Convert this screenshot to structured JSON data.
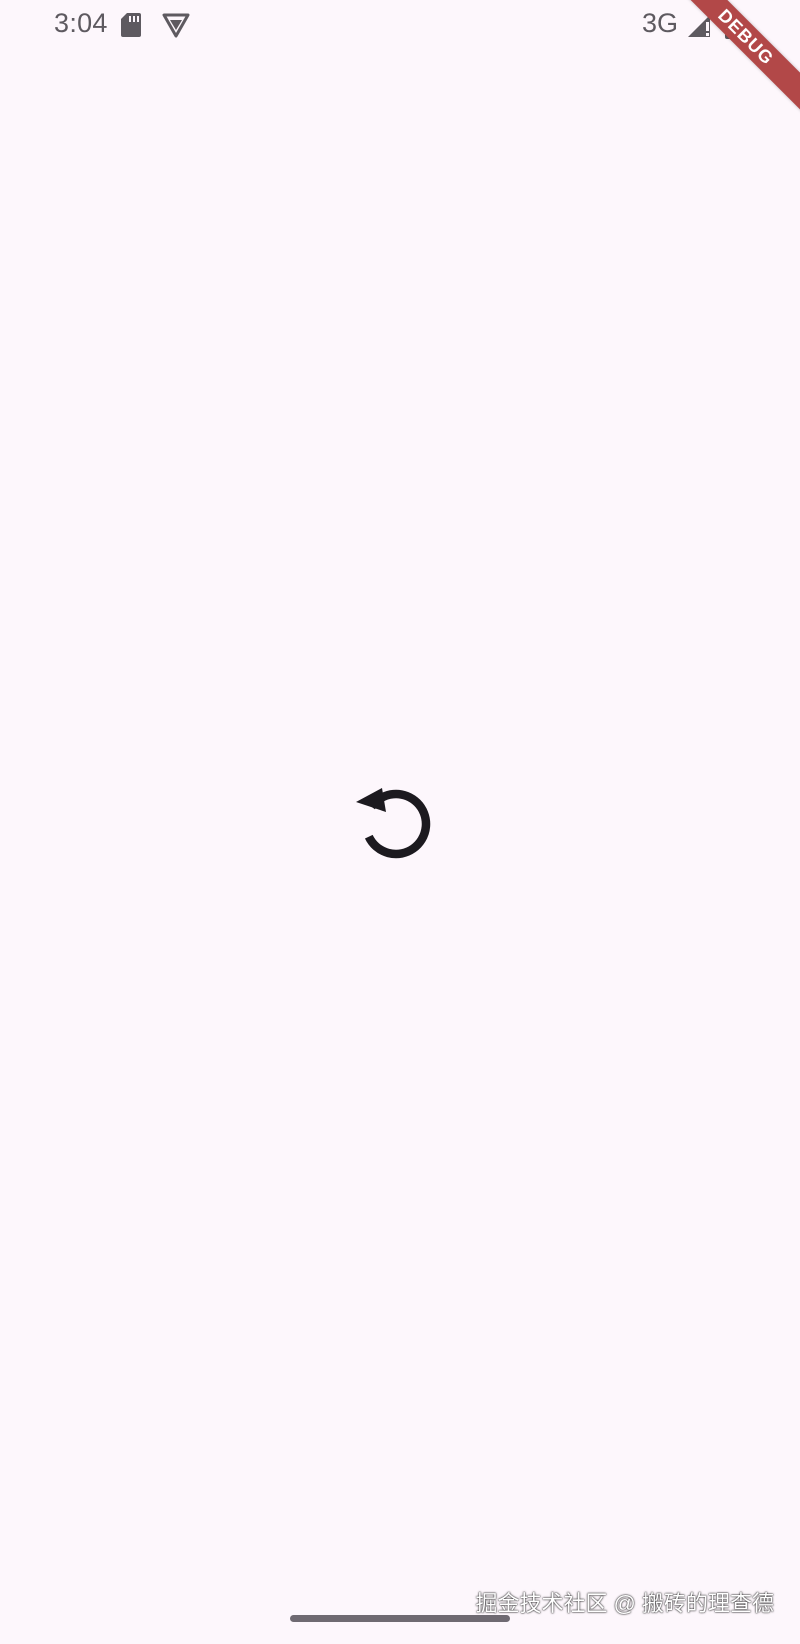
{
  "status_bar": {
    "time": "3:04",
    "network": "3G",
    "icons": [
      "sd-card-icon",
      "vpn-shield-icon",
      "signal-icon",
      "battery-icon"
    ]
  },
  "debug_banner": {
    "label": "DEBUG",
    "color": "#b24848"
  },
  "main": {
    "refresh_icon": "refresh-icon"
  },
  "watermark": {
    "text": "掘金技术社区 @ 搬砖的理查德"
  },
  "colors": {
    "background": "#fdf7fc",
    "icon": "#1c1a1f",
    "status_text": "#5e5a60"
  }
}
